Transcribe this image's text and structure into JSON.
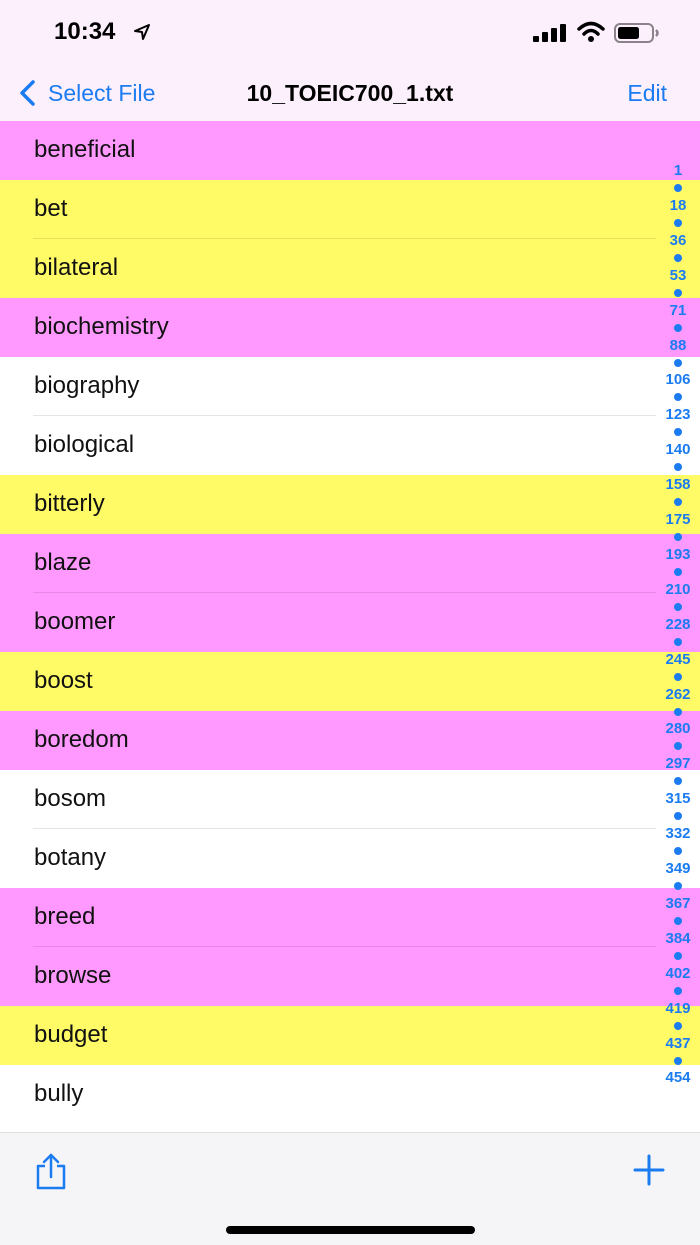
{
  "status": {
    "time": "10:34"
  },
  "nav": {
    "back_label": "Select File",
    "title": "10_TOEIC700_1.txt",
    "edit_label": "Edit"
  },
  "colors": {
    "accent": "#1b7cf2",
    "pink": "#ff99ff",
    "yellow": "#fffb66",
    "white": "#ffffff"
  },
  "words": [
    {
      "label": "beneficial",
      "color": "pink"
    },
    {
      "label": "bet",
      "color": "yellow"
    },
    {
      "label": "bilateral",
      "color": "yellow"
    },
    {
      "label": "biochemistry",
      "color": "pink"
    },
    {
      "label": "biography",
      "color": "white"
    },
    {
      "label": "biological",
      "color": "white"
    },
    {
      "label": "bitterly",
      "color": "yellow"
    },
    {
      "label": "blaze",
      "color": "pink"
    },
    {
      "label": "boomer",
      "color": "pink"
    },
    {
      "label": "boost",
      "color": "yellow"
    },
    {
      "label": "boredom",
      "color": "pink"
    },
    {
      "label": "bosom",
      "color": "white"
    },
    {
      "label": "botany",
      "color": "white"
    },
    {
      "label": "breed",
      "color": "pink"
    },
    {
      "label": "browse",
      "color": "pink"
    },
    {
      "label": "budget",
      "color": "yellow"
    },
    {
      "label": "bully",
      "color": "white"
    }
  ],
  "index": [
    "1",
    "18",
    "36",
    "53",
    "71",
    "88",
    "106",
    "123",
    "140",
    "158",
    "175",
    "193",
    "210",
    "228",
    "245",
    "262",
    "280",
    "297",
    "315",
    "332",
    "349",
    "367",
    "384",
    "402",
    "419",
    "437",
    "454"
  ],
  "icons": {
    "share": "share-icon",
    "add": "plus-icon"
  }
}
